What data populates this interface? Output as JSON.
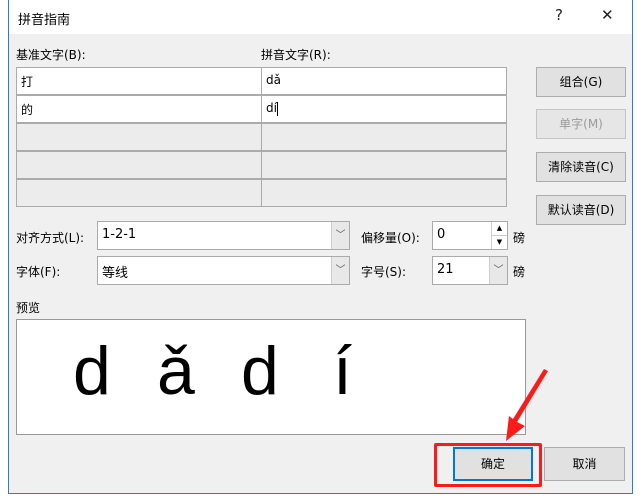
{
  "title": "拼音指南",
  "help": "?",
  "close": "✕",
  "base_label": "基准文字(B):",
  "ruby_label": "拼音文字(R):",
  "rows": [
    {
      "base": "打",
      "ruby": "dǎ"
    },
    {
      "base": "的",
      "ruby": "dí"
    },
    {
      "base": "",
      "ruby": ""
    },
    {
      "base": "",
      "ruby": ""
    },
    {
      "base": "",
      "ruby": ""
    }
  ],
  "buttons": {
    "group": "组合(G)",
    "mono": "单字(M)",
    "clear": "清除读音(C)",
    "default": "默认读音(D)",
    "ok": "确定",
    "cancel": "取消"
  },
  "alignment": {
    "label": "对齐方式(L):",
    "value": "1-2-1"
  },
  "offset": {
    "label": "偏移量(O):",
    "value": "0",
    "unit": "磅"
  },
  "font": {
    "label": "字体(F):",
    "value": "等线"
  },
  "size": {
    "label": "字号(S):",
    "value": "21",
    "unit": "磅"
  },
  "preview": {
    "label": "预览",
    "glyphs": [
      "d",
      "ǎ",
      "d",
      "í"
    ]
  },
  "highlight_color": "#ff1a1a"
}
